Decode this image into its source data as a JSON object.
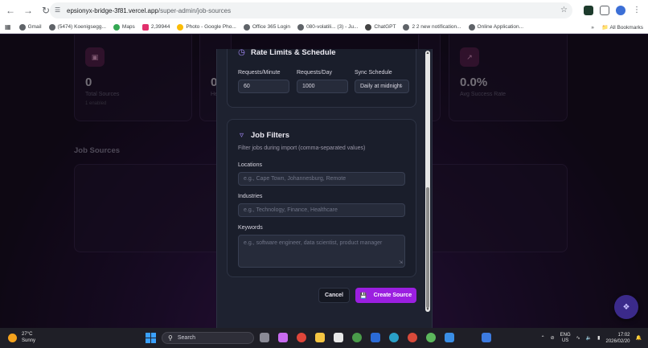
{
  "browser": {
    "url_host": "epsionyx-bridge-3f81.vercel.app",
    "url_path": "/super-admin/job-sources",
    "bookmarks": [
      "Gmail",
      "(5474) Koenigsegg...",
      "Maps",
      "2,39944",
      "Photo - Google Pho...",
      "Office 365 Login",
      "080-volatili... (3) - Ju...",
      "ChatGPT",
      "2 2 new notification...",
      "Online Application..."
    ],
    "more_label": "»",
    "all_bookmarks": "All Bookmarks"
  },
  "stats": {
    "total_value": "0",
    "total_label": "Total Sources",
    "total_sub": "1 enabled",
    "second_value": "0",
    "second_label": "He",
    "rate_value": "0.0%",
    "rate_label": "Avg Success Rate"
  },
  "page": {
    "section_title": "Job Sources"
  },
  "modal": {
    "rate_title": "Rate Limits & Schedule",
    "req_min_label": "Requests/Minute",
    "req_min_value": "60",
    "req_day_label": "Requests/Day",
    "req_day_value": "1000",
    "sync_label": "Sync Schedule",
    "sync_value": "Daily at midnight",
    "filters_title": "Job Filters",
    "filters_hint": "Filter jobs during import (comma-separated values)",
    "locations_label": "Locations",
    "locations_placeholder": "e.g., Cape Town, Johannesburg, Remote",
    "industries_label": "Industries",
    "industries_placeholder": "e.g., Technology, Finance, Healthcare",
    "keywords_label": "Keywords",
    "keywords_placeholder": "e.g., software engineer, data scientist, product manager",
    "cancel_label": "Cancel",
    "create_label": "Create Source"
  },
  "taskbar": {
    "temp": "27°C",
    "weather": "Sunny",
    "search": "Search",
    "lang1": "ENG",
    "lang2": "US",
    "time": "17:02",
    "date": "2026/02/20"
  },
  "colors": {
    "accent": "#9b1fe0",
    "icon_accent": "#a78bfa"
  }
}
